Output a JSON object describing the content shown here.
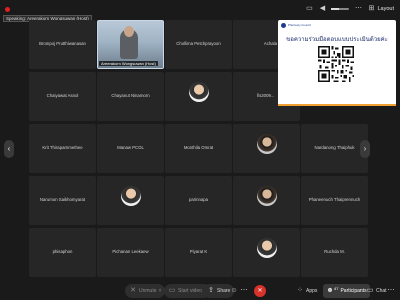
{
  "topbar": {
    "speaking_text": "Speaking: Areerakorn Wongsuwan (Host)",
    "layout_label": "Layout"
  },
  "tiles": [
    {
      "name": "Brompoj Prutthiwanasan"
    },
    {
      "name": "Areerakorn Wongsuwan (Host)",
      "video": true
    },
    {
      "name": "Chollima Petchprayoon"
    },
    {
      "name": "Achala"
    },
    {
      "name": "Chaiyawat Asnol"
    },
    {
      "name": "Chayanut Ninamorn"
    },
    {
      "name": "",
      "avatar": "photo"
    },
    {
      "name": "fis2009..."
    },
    {
      "name": "Krit Thiraparnmethee"
    },
    {
      "name": "Manaw PCOL"
    },
    {
      "name": "Monthila Omrat"
    },
    {
      "name": "",
      "avatar": "photo"
    },
    {
      "name": "Nardanong Thaiphuk"
    },
    {
      "name": "Narumon Saikhomyarat"
    },
    {
      "name": "",
      "avatar": "photo"
    },
    {
      "name": "parinnapa"
    },
    {
      "name": "",
      "avatar": "photo"
    },
    {
      "name": "Phaneenuch Thaiprennuch"
    },
    {
      "name": "phisaphon"
    },
    {
      "name": "Pichanan Leekaew"
    },
    {
      "name": "Piyarat K"
    },
    {
      "name": "",
      "avatar": "photo"
    },
    {
      "name": "Ruchda M."
    }
  ],
  "share": {
    "brand": "Pharmacy Council",
    "title": "ขอความร่วมมือตอบแบบประเมินด้วยค่ะ"
  },
  "toolbar": {
    "unmute": "Unmute",
    "start_video": "Start video",
    "share": "Share",
    "apps": "Apps",
    "participants": "Participants",
    "participants_count": "47",
    "chat": "Chat"
  },
  "colors": {
    "background": "#1a1a1a",
    "tile": "#262626",
    "leave": "#d9322a",
    "record": "#e02020"
  }
}
